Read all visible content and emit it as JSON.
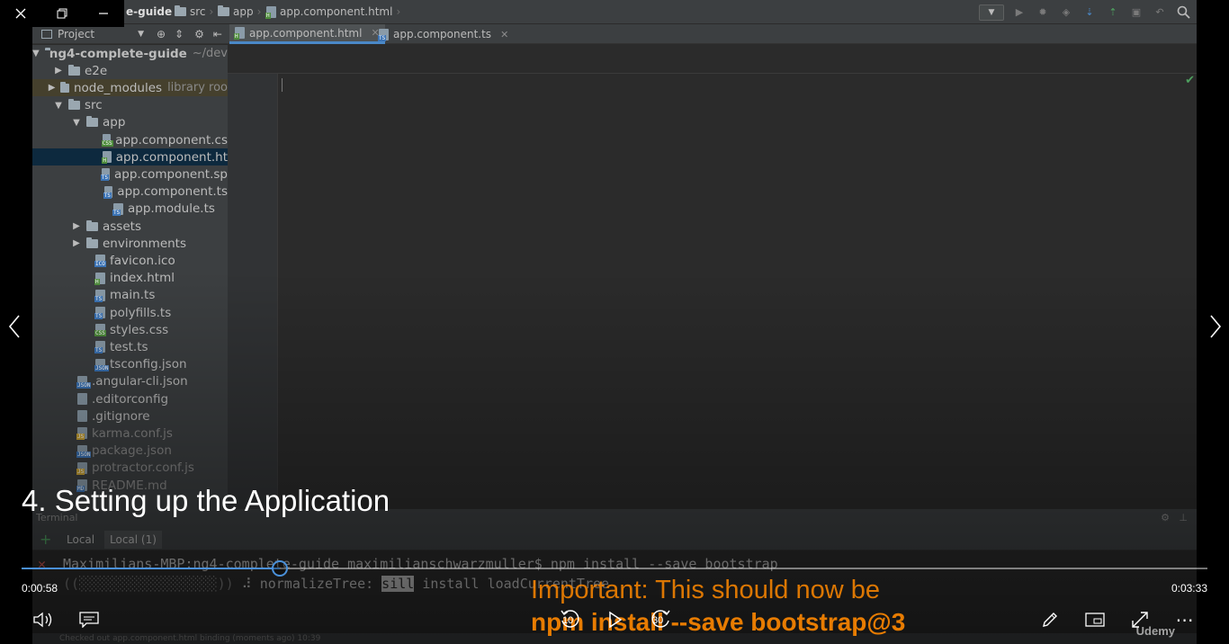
{
  "breadcrumbs": [
    {
      "label": "e-guide",
      "icon": "folder-icon"
    },
    {
      "label": "src",
      "icon": "folder-icon"
    },
    {
      "label": "app",
      "icon": "folder-icon"
    },
    {
      "label": "app.component.html",
      "icon": "html-file-icon"
    }
  ],
  "project_panel": {
    "title": "Project"
  },
  "tree": [
    {
      "label": "ng4-complete-guide",
      "extra": "~/dev",
      "type": "folder",
      "expanded": true,
      "depth": 0,
      "bold": true
    },
    {
      "label": "e2e",
      "type": "folder",
      "expanded": false,
      "depth": 1
    },
    {
      "label": "node_modules",
      "extra": "library roo",
      "type": "folder",
      "expanded": false,
      "depth": 1,
      "library": true
    },
    {
      "label": "src",
      "type": "folder",
      "expanded": true,
      "depth": 1
    },
    {
      "label": "app",
      "type": "folder",
      "expanded": true,
      "depth": 2
    },
    {
      "label": "app.component.cs",
      "type": "file",
      "tag": "css",
      "depth": 4
    },
    {
      "label": "app.component.ht",
      "type": "file",
      "tag": "html",
      "depth": 4,
      "selected": true
    },
    {
      "label": "app.component.sp",
      "type": "file",
      "tag": "ts",
      "depth": 4
    },
    {
      "label": "app.component.ts",
      "type": "file",
      "tag": "ts",
      "depth": 4
    },
    {
      "label": "app.module.ts",
      "type": "file",
      "tag": "ts",
      "depth": 4
    },
    {
      "label": "assets",
      "type": "folder",
      "expanded": false,
      "depth": 2
    },
    {
      "label": "environments",
      "type": "folder",
      "expanded": false,
      "depth": 2
    },
    {
      "label": "favicon.ico",
      "type": "file",
      "tag": "ico",
      "depth": 3
    },
    {
      "label": "index.html",
      "type": "file",
      "tag": "html",
      "depth": 3
    },
    {
      "label": "main.ts",
      "type": "file",
      "tag": "ts",
      "depth": 3
    },
    {
      "label": "polyfills.ts",
      "type": "file",
      "tag": "ts",
      "depth": 3
    },
    {
      "label": "styles.css",
      "type": "file",
      "tag": "css",
      "depth": 3
    },
    {
      "label": "test.ts",
      "type": "file",
      "tag": "ts",
      "depth": 3
    },
    {
      "label": "tsconfig.json",
      "type": "file",
      "tag": "json",
      "depth": 3
    },
    {
      "label": ".angular-cli.json",
      "type": "file",
      "tag": "json",
      "depth": 2
    },
    {
      "label": ".editorconfig",
      "type": "file",
      "tag": "cfg",
      "depth": 2
    },
    {
      "label": ".gitignore",
      "type": "file",
      "tag": "git",
      "depth": 2
    },
    {
      "label": "karma.conf.js",
      "type": "file",
      "tag": "js",
      "depth": 2,
      "muted": true
    },
    {
      "label": "package.json",
      "type": "file",
      "tag": "json",
      "depth": 2,
      "muted": true
    },
    {
      "label": "protractor.conf.js",
      "type": "file",
      "tag": "js",
      "depth": 2,
      "muted": true
    },
    {
      "label": "README.md",
      "type": "file",
      "tag": "md",
      "depth": 2,
      "muted": true
    }
  ],
  "editor_tabs": [
    {
      "label": "app.component.html",
      "tag": "html",
      "active": true
    },
    {
      "label": "app.component.ts",
      "tag": "ts",
      "active": false
    }
  ],
  "terminal": {
    "title": "Terminal",
    "tabs": [
      {
        "label": "Local",
        "active": false
      },
      {
        "label": "Local (1)",
        "active": true
      }
    ],
    "line1": "Maximilians-MBP:ng4-complete-guide maximilianschwarzmuller$ npm install --save bootstrap",
    "line2_progress": "((░░░░░░░░░░░░░░░░░))",
    "line2_prefix": " ⠼ normalizeTree: ",
    "line2_highlight": "sill",
    "line2_rest": " install loadCurrentTree",
    "status": "Checked out app.component.html binding (moments ago) 10:39"
  },
  "video": {
    "lecture_title": "4. Setting up the Application",
    "elapsed": "0:00:58",
    "duration": "0:03:33",
    "progress": 0.218,
    "caption_line1": "Important: This should now be",
    "caption_line2": "npm install --save bootstrap@3",
    "rewind_seconds": "10",
    "forward_seconds": "30",
    "watermark": "Udemy"
  },
  "colors": {
    "accent": "#4a90d9",
    "caption": "#ff8800",
    "ide_bg": "#2b2b2b",
    "panel_bg": "#3c3f41",
    "selection": "#0d293e"
  }
}
